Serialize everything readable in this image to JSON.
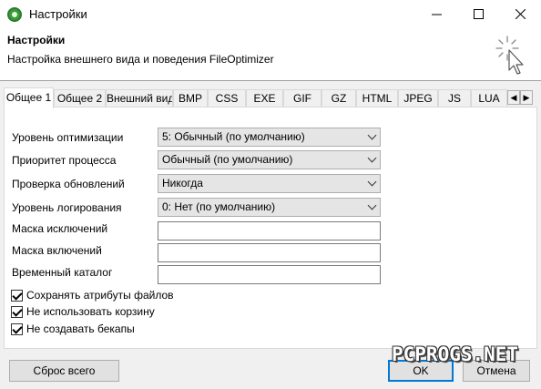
{
  "window": {
    "title": "Настройки",
    "minimize_icon": "minimize-icon",
    "maximize_icon": "maximize-icon",
    "close_icon": "close-icon"
  },
  "header": {
    "title": "Настройки",
    "subtitle": "Настройка внешнего вида и поведения FileOptimizer"
  },
  "tabs": [
    {
      "label": "Общее 1",
      "active": true
    },
    {
      "label": "Общее 2"
    },
    {
      "label": "Внешний вид"
    },
    {
      "label": "BMP"
    },
    {
      "label": "CSS"
    },
    {
      "label": "EXE"
    },
    {
      "label": "GIF"
    },
    {
      "label": "GZ"
    },
    {
      "label": "HTML"
    },
    {
      "label": "JPEG"
    },
    {
      "label": "JS"
    },
    {
      "label": "LUA"
    }
  ],
  "tab_scroll": {
    "left": "◀",
    "right": "▶"
  },
  "form": {
    "optimization_level": {
      "label": "Уровень оптимизации",
      "value": "5: Обычный (по умолчанию)"
    },
    "process_priority": {
      "label": "Приоритет процесса",
      "value": "Обычный (по умолчанию)"
    },
    "update_check": {
      "label": "Проверка обновлений",
      "value": "Никогда"
    },
    "log_level": {
      "label": "Уровень логирования",
      "value": "0: Нет (по умолчанию)"
    },
    "exclude_mask": {
      "label": "Маска исключений",
      "value": ""
    },
    "include_mask": {
      "label": "Маска включений",
      "value": ""
    },
    "temp_dir": {
      "label": "Временный каталог",
      "value": ""
    }
  },
  "checkboxes": [
    {
      "label": "Сохранять атрибуты файлов",
      "checked": true
    },
    {
      "label": "Не использовать корзину",
      "checked": true
    },
    {
      "label": "Не создавать бекапы",
      "checked": true
    }
  ],
  "buttons": {
    "reset": "Сброс всего",
    "ok": "OK",
    "cancel": "Отмена"
  },
  "watermark": "PCPROGS.NET",
  "colors": {
    "accent": "#0078d7",
    "app_icon": "#3a9b3a"
  }
}
